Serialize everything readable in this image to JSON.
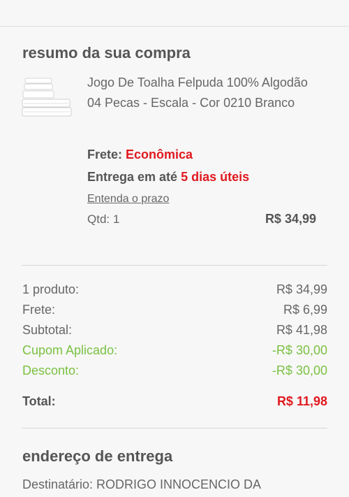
{
  "summary": {
    "title": "resumo da sua compra"
  },
  "product": {
    "name": "Jogo De Toalha Felpuda 100% Algodão 04 Pecas - Escala - Cor 0210 Branco",
    "shipping_label": "Frete: ",
    "shipping_value": "Econômica",
    "delivery_label": "Entrega em até ",
    "delivery_value": "5 dias úteis",
    "deadline_link": "Entenda o prazo",
    "quantity": "Qtd: 1",
    "price": "R$ 34,99",
    "image_icon": "towel-set-icon"
  },
  "totals": [
    {
      "label": "1 produto:",
      "value": "R$ 34,99",
      "style": "normal"
    },
    {
      "label": "Frete:",
      "value": "R$ 6,99",
      "style": "normal"
    },
    {
      "label": "Subtotal:",
      "value": "R$ 41,98",
      "style": "normal"
    },
    {
      "label": "Cupom Aplicado:",
      "value": "-R$ 30,00",
      "style": "discount"
    },
    {
      "label": "Desconto:",
      "value": "-R$ 30,00",
      "style": "discount"
    }
  ],
  "grand_total": {
    "label": "Total:",
    "value": "R$ 11,98"
  },
  "address": {
    "title": "endereço de entrega",
    "recipient": "Destinatário: RODRIGO INNOCENCIO DA"
  },
  "colors": {
    "accent_red": "#e0191f",
    "discount_green": "#7ac142",
    "text": "#555555",
    "background": "#f7f7f7"
  }
}
